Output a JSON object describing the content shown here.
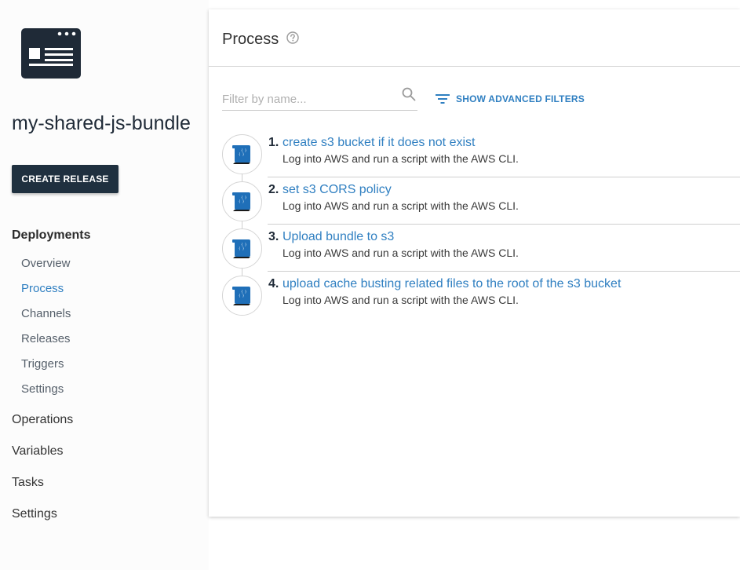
{
  "sidebar": {
    "project_name": "my-shared-js-bundle",
    "create_release_label": "CREATE RELEASE",
    "deployments_label": "Deployments",
    "deployments_items": [
      {
        "label": "Overview",
        "active": false
      },
      {
        "label": "Process",
        "active": true
      },
      {
        "label": "Channels",
        "active": false
      },
      {
        "label": "Releases",
        "active": false
      },
      {
        "label": "Triggers",
        "active": false
      },
      {
        "label": "Settings",
        "active": false
      }
    ],
    "sections": [
      {
        "label": "Operations"
      },
      {
        "label": "Variables"
      },
      {
        "label": "Tasks"
      },
      {
        "label": "Settings"
      }
    ]
  },
  "main": {
    "title": "Process",
    "filter": {
      "placeholder": "Filter by name...",
      "value": ""
    },
    "advanced_filters_label": "SHOW ADVANCED FILTERS",
    "steps": [
      {
        "number": "1.",
        "title": "create s3 bucket if it does not exist",
        "description": "Log into AWS and run a script with the AWS CLI."
      },
      {
        "number": "2.",
        "title": "set s3 CORS policy",
        "description": "Log into AWS and run a script with the AWS CLI."
      },
      {
        "number": "3.",
        "title": "Upload bundle to s3",
        "description": "Log into AWS and run a script with the AWS CLI."
      },
      {
        "number": "4.",
        "title": "upload cache busting related files to the root of the s3 bucket",
        "description": "Log into AWS and run a script with the AWS CLI."
      }
    ]
  },
  "colors": {
    "accent": "#2f7fc1",
    "dark": "#1f303f",
    "step_icon": "#1f6fb8"
  },
  "icons": {
    "project_logo": "browser-window-icon",
    "help": "help-circle-icon",
    "search": "search-icon",
    "filter": "filter-lines-icon",
    "step": "aws-cli-script-icon"
  }
}
